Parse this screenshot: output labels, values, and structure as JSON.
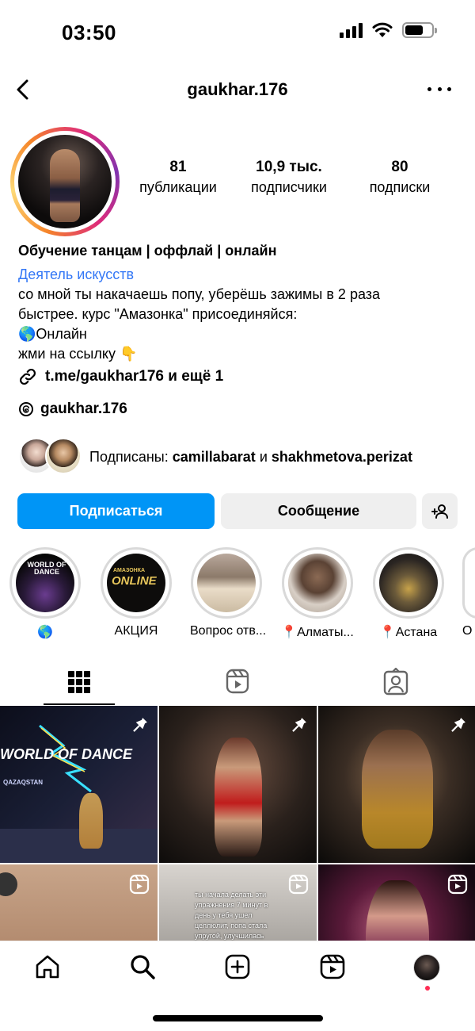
{
  "status": {
    "time": "03:50"
  },
  "header": {
    "username": "gaukhar.176"
  },
  "stats": [
    {
      "value": "81",
      "label": "публикации"
    },
    {
      "value": "10,9 тыс.",
      "label": "подписчики"
    },
    {
      "value": "80",
      "label": "подписки"
    }
  ],
  "bio": {
    "name": "Обучение танцам | оффлай | онлайн",
    "category": "Деятель искусств",
    "lines": [
      "со мной ты накачаешь попу, уберёшь зажимы в 2 раза",
      "быстрее. курс \"Амазонка\" присоединяйся:",
      "🌎Онлайн",
      "жми на ссылку 👇"
    ],
    "link": "t.me/gaukhar176 и ещё 1",
    "threads": "gaukhar.176"
  },
  "followed_by": {
    "prefix": "Подписаны: ",
    "user1": "camillabarat",
    "joiner": " и ",
    "user2": "shakhmetova.perizat"
  },
  "buttons": {
    "follow": "Подписаться",
    "message": "Сообщение"
  },
  "highlights": [
    {
      "label": "🌎",
      "cover_text": "WORLD OF DANCE"
    },
    {
      "label": "АКЦИЯ",
      "cover_text_small": "АМАЗОНКА",
      "cover_text": "ONLINE"
    },
    {
      "label": "Вопрос отв..."
    },
    {
      "label": "📍Алматы..."
    },
    {
      "label": "📍Астана"
    },
    {
      "label": "О"
    }
  ],
  "grid": {
    "post1": {
      "title": "WORLD OF DANCE",
      "subtitle": "QAZAQSTAN",
      "badge": "pin-icon"
    },
    "post2": {
      "badge": "pin-icon"
    },
    "post3": {
      "badge": "pin-icon"
    },
    "post4": {
      "badge": "reel-icon"
    },
    "post5": {
      "badge": "reel-icon",
      "caption": "ты начала делать эти упражнения 7 минут в день у тебя ушел целлюлит, попа стала упругой, улучшилась осанка"
    },
    "post6": {
      "badge": "reel-icon"
    }
  },
  "colors": {
    "accent": "#0095f6",
    "link": "#3478f6",
    "notification": "#ff2d55"
  }
}
